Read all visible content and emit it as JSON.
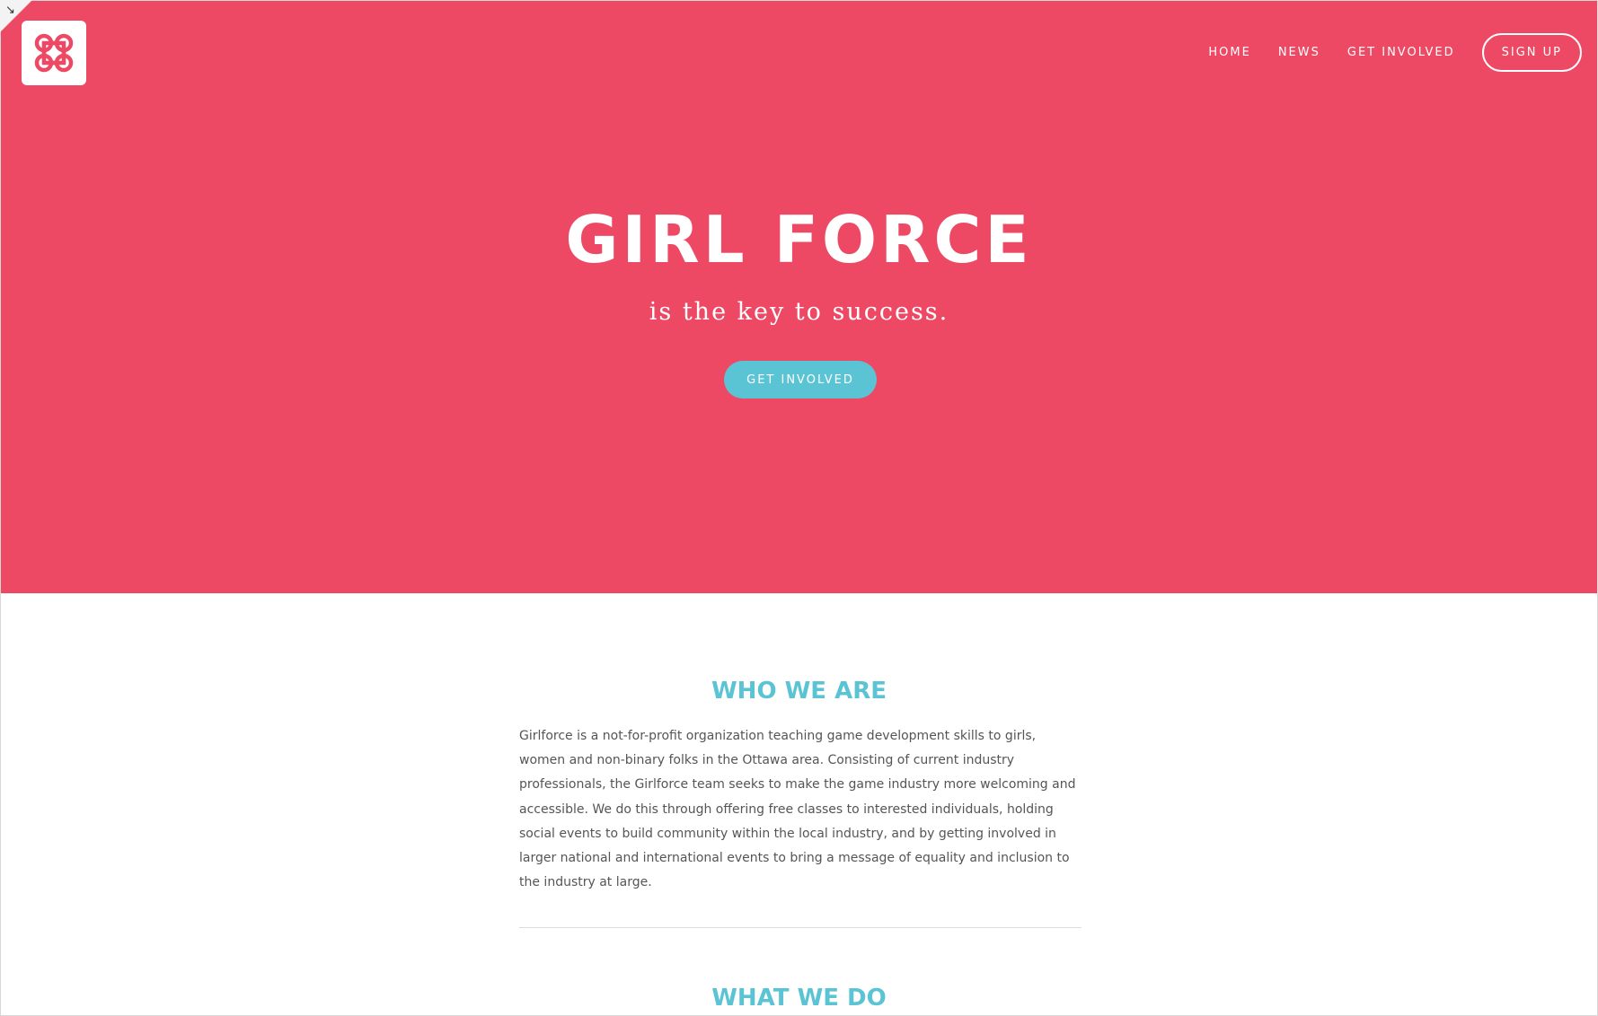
{
  "colors": {
    "hero_bg": "#ee4964",
    "accent": "#5bc4d4",
    "body_text": "#555555"
  },
  "logo": {
    "icon": "command-key-icon"
  },
  "nav": {
    "items": [
      {
        "label": "HOME"
      },
      {
        "label": "NEWS"
      },
      {
        "label": "GET INVOLVED"
      }
    ],
    "signup_label": "SIGN UP"
  },
  "hero": {
    "title": "GIRL FORCE",
    "subtitle": "is the key to success.",
    "cta_label": "GET INVOLVED"
  },
  "who_we_are": {
    "heading": "WHO WE ARE",
    "body": "Girlforce is a not-for-profit organization teaching game development skills to girls, women and non-binary folks in the Ottawa area. Consisting of current industry professionals, the Girlforce team seeks to make the game industry more welcoming and accessible. We do this through offering free classes to interested individuals, holding social events to build community within the local industry, and by getting involved in larger national and international events to bring a message of equality and inclusion to the industry at large."
  },
  "what_we_do": {
    "heading": "WHAT WE DO"
  }
}
